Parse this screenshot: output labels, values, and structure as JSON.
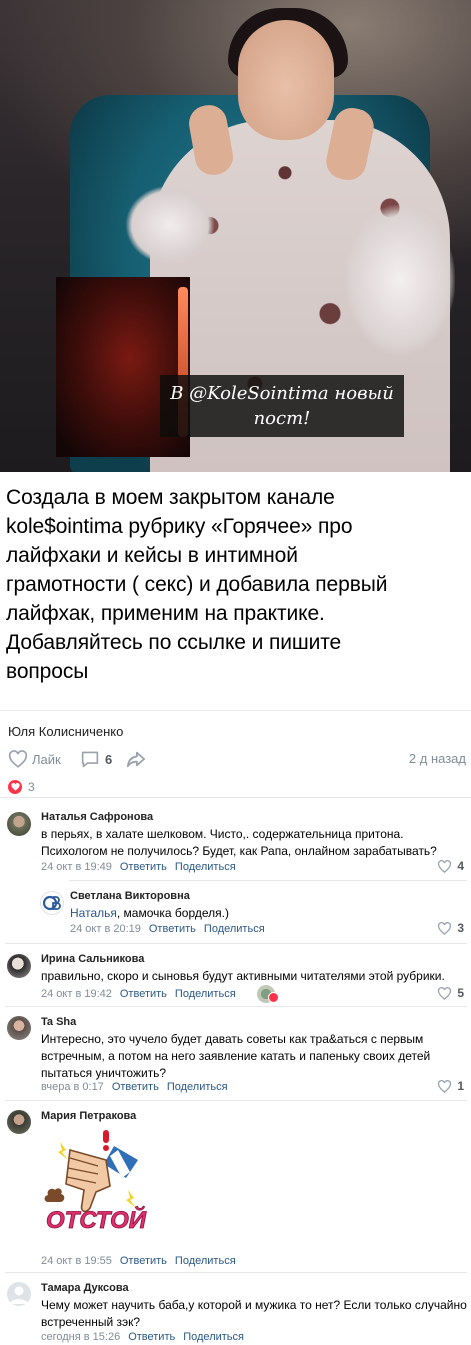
{
  "media": {
    "caption_line1": "В @KoleSointima новый",
    "caption_line2": "пост!"
  },
  "post": {
    "text_lines": [
      "Создала в моем закрытом канале",
      "kole$ointima рубрику «Горячее» про",
      "лайфхаки и кейсы в интимной",
      "грамотности ( секс) и добавила первый",
      "лайфхак, применим на практике.",
      "Добавляйтесь по ссылке и пишите",
      "вопросы"
    ],
    "author": "Юля Колисниченко",
    "like_label": "Лайк",
    "comments_count": "6",
    "time_ago": "2 д назад",
    "reactions_count": "3",
    "colors": {
      "link": "#2a5885",
      "secondary": "#818c99",
      "heart": "#ff3347",
      "separator": "#e7e8ec"
    }
  },
  "comments": [
    {
      "name": "Наталья Сафронова",
      "lines": [
        "в перьях, в халате шелковом. Чисто,. содержательница притона.",
        "Психологом не получилось? Будет, как Рапа, онлайном зарабатывать?"
      ],
      "time": "24 окт в 19:49",
      "reply": "Ответить",
      "share": "Поделиться",
      "likes": "4"
    },
    {
      "name": "Светлана Викторовна",
      "mention": "Наталья",
      "text": ", мамочка борделя.)",
      "time": "24 окт в 20:19",
      "reply": "Ответить",
      "share": "Поделиться",
      "likes": "3"
    },
    {
      "name": "Ирина Сальникова",
      "lines": [
        "правильно, скоро и сыновья будут активными читателями этой рубрики."
      ],
      "time": "24 окт в 19:42",
      "reply": "Ответить",
      "share": "Поделиться",
      "likes": "5"
    },
    {
      "name": "Ta Sha",
      "lines": [
        "Интересно, это чучело будет давать советы как тра&аться с первым",
        "встречным, а потом на него заявление катать и папеньку своих детей",
        "пытаться уничтожить?"
      ],
      "time": "вчера в 0:17",
      "reply": "Ответить",
      "share": "Поделиться",
      "likes": "1"
    },
    {
      "name": "Мария Петракова",
      "sticker_text": "ОТСТОЙ",
      "time": "24 окт в 19:55",
      "reply": "Ответить",
      "share": "Поделиться"
    },
    {
      "name": "Тамара Дуксова",
      "lines": [
        "Чему может научить баба,у которой и мужика то нет? Если только случайно",
        "встреченный зэк?"
      ],
      "time": "сегодня в 15:26",
      "reply": "Ответить",
      "share": "Поделиться"
    }
  ]
}
